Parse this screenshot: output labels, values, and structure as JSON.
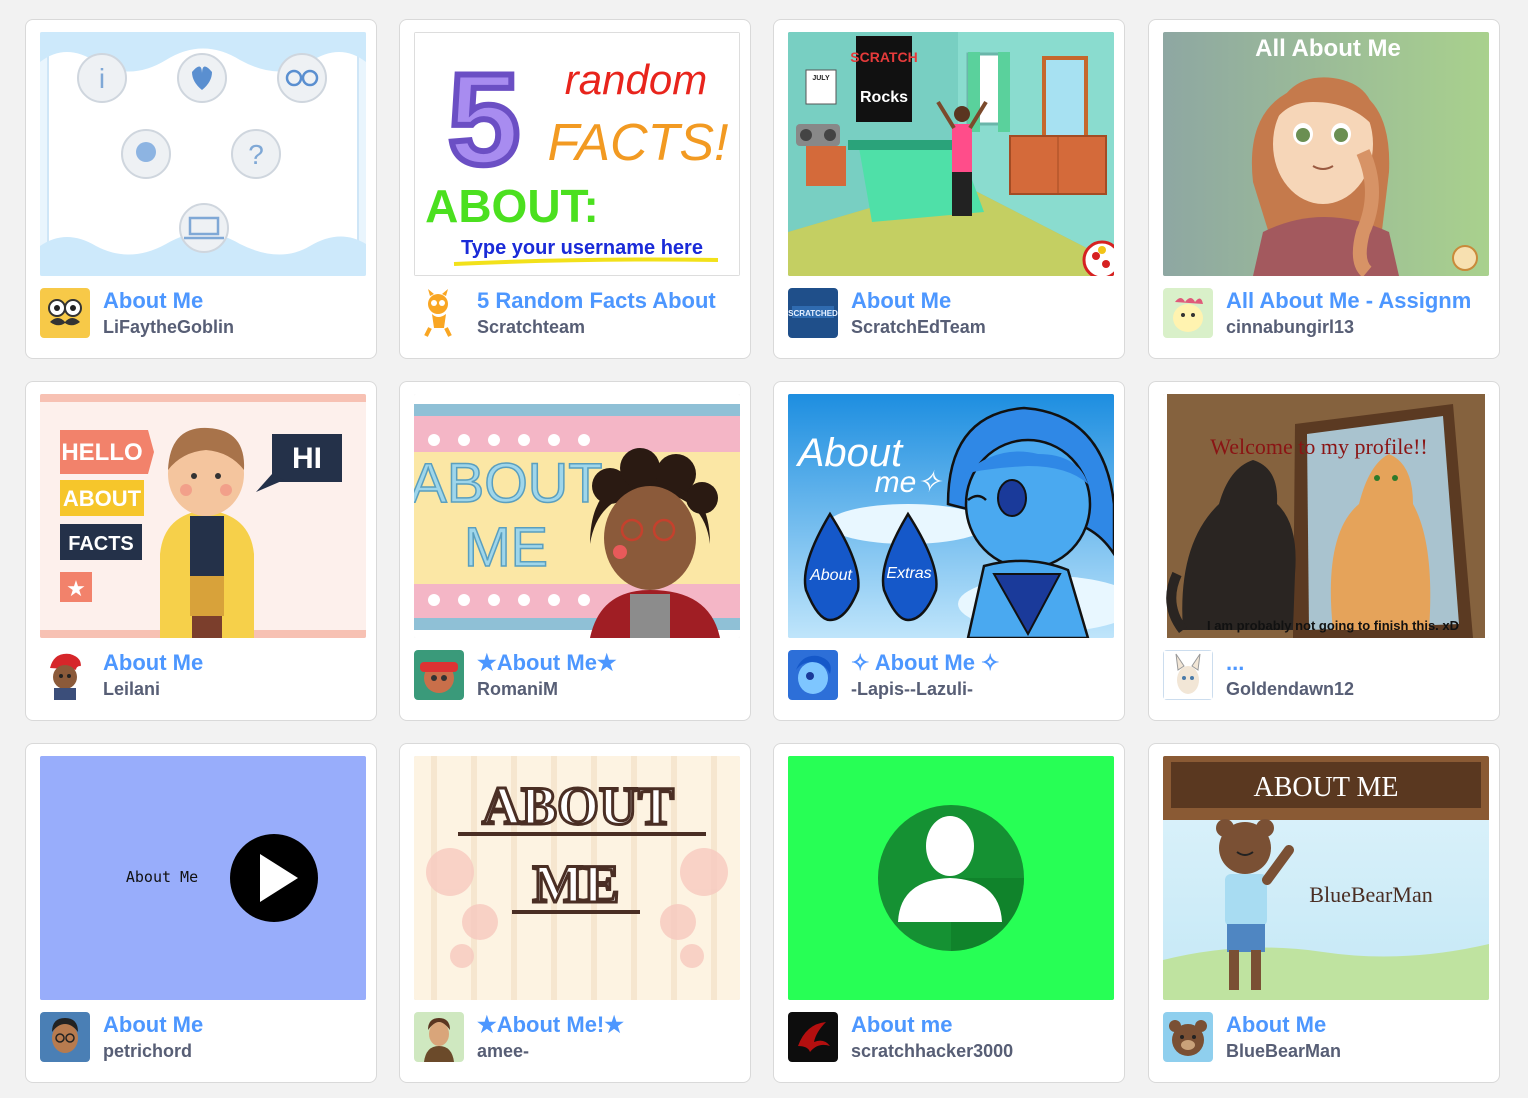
{
  "projects": [
    {
      "title": "About Me",
      "author": "LiFaytheGoblin"
    },
    {
      "title": "5 Random Facts About",
      "author": "Scratchteam",
      "thumb": {
        "word1": "random",
        "word2": "FACTS!",
        "word3": "ABOUT:",
        "line": "Type your username here"
      }
    },
    {
      "title": "About Me",
      "author": "ScratchEdTeam",
      "thumb": {
        "poster1": "SCRATCH",
        "poster2": "Rocks",
        "calendar": "JULY"
      }
    },
    {
      "title": "All About Me - Assignm",
      "author": "cinnabungirl13",
      "thumb": {
        "heading": "All About Me"
      }
    },
    {
      "title": "About Me",
      "author": "Leilani",
      "thumb": {
        "tag1": "HELLO",
        "tag2": "ABOUT",
        "tag3": "FACTS",
        "bubble": "HI"
      }
    },
    {
      "title": "★About Me★",
      "author": "RomaniM",
      "thumb": {
        "line1": "ABOUT",
        "line2": "ME"
      }
    },
    {
      "title": "✧ About Me ✧",
      "author": "-Lapis--Lazuli-",
      "thumb": {
        "heading1": "About",
        "heading2": "me✧",
        "drop1": "About",
        "drop2": "Extras"
      }
    },
    {
      "title": "...",
      "author": "Goldendawn12",
      "thumb": {
        "heading": "Welcome to my profile!!",
        "footer": "I am probably not going to finish this. xD"
      }
    },
    {
      "title": "About Me",
      "author": "petrichord",
      "thumb": {
        "label": "About Me"
      }
    },
    {
      "title": "★About Me!★",
      "author": "amee-",
      "thumb": {
        "line1": "ABOUT",
        "line2": "ME"
      }
    },
    {
      "title": "About me",
      "author": "scratchhacker3000"
    },
    {
      "title": "About Me",
      "author": "BlueBearMan",
      "thumb": {
        "banner": "ABOUT ME",
        "name": "BlueBearMan"
      }
    }
  ],
  "colors": {
    "title_link": "#4d97ff",
    "author_text": "#575e75",
    "page_bg": "#f2f2f2",
    "card_bg": "#ffffff"
  }
}
